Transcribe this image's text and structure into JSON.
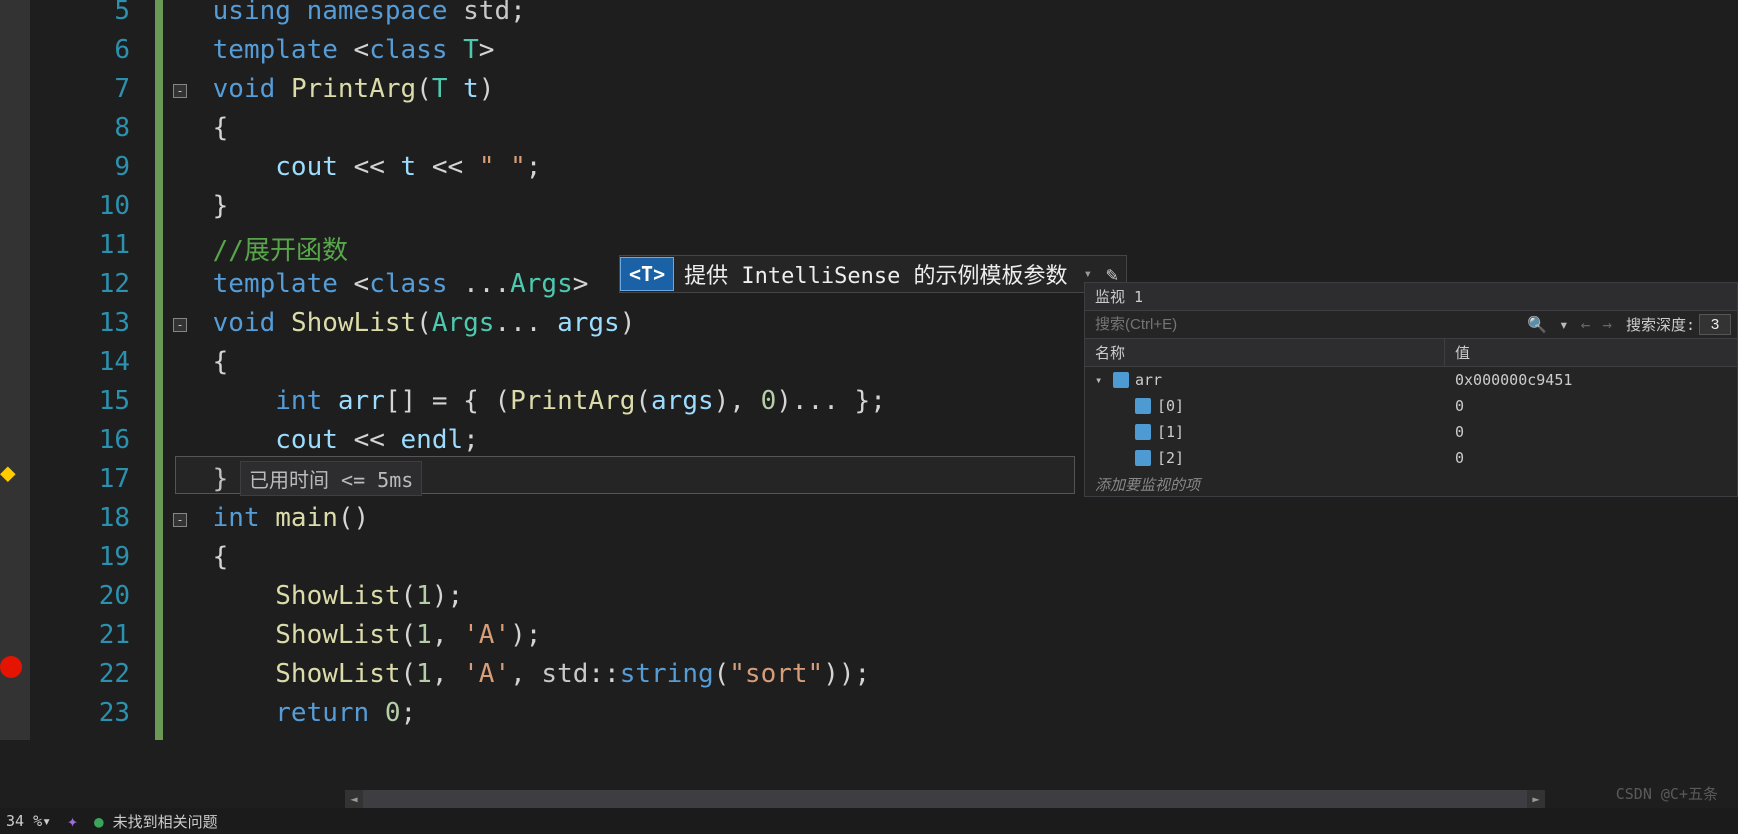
{
  "lines": [
    {
      "num": 5,
      "html": " <span class='kw'>using</span> <span class='kw'>namespace</span> <span class='ns'>std</span><span class='punc'>;</span>"
    },
    {
      "num": 6,
      "html": " <span class='kw'>template</span> <span class='punc'>&lt;</span><span class='kw'>class</span> <span class='tparam'>T</span><span class='punc'>&gt;</span>"
    },
    {
      "num": 7,
      "html": " <span class='kw'>void</span> <span class='func'>PrintArg</span><span class='punc'>(</span><span class='tparam'>T</span> <span class='ident'>t</span><span class='punc'>)</span>",
      "fold": true
    },
    {
      "num": 8,
      "html": " <span class='punc'>{</span>"
    },
    {
      "num": 9,
      "html": "     <span class='ident'>cout</span> <span class='op'>&lt;&lt;</span> <span class='ident'>t</span> <span class='op'>&lt;&lt;</span> <span class='str'>\" \"</span><span class='punc'>;</span>"
    },
    {
      "num": 10,
      "html": " <span class='punc'>}</span>"
    },
    {
      "num": 11,
      "html": " <span class='comment'>//展开函数</span>"
    },
    {
      "num": 12,
      "html": " <span class='kw'>template</span> <span class='punc'>&lt;</span><span class='kw'>class</span> <span class='punc'>...</span><span class='tparam'>Args</span><span class='punc'>&gt;</span>"
    },
    {
      "num": 13,
      "html": " <span class='kw'>void</span> <span class='func'>ShowList</span><span class='punc'>(</span><span class='tparam'>Args</span><span class='punc'>...</span> <span class='ident'>args</span><span class='punc'>)</span>",
      "fold": true
    },
    {
      "num": 14,
      "html": " <span class='punc'>{</span>"
    },
    {
      "num": 15,
      "html": "     <span class='kw'>int</span> <span class='ident'>arr</span><span class='punc'>[]</span> <span class='op'>=</span> <span class='punc'>{</span> <span class='punc'>(</span><span class='func'>PrintArg</span><span class='punc'>(</span><span class='ident'>args</span><span class='punc'>),</span> <span class='num'>0</span><span class='punc'>)...</span> <span class='punc'>};</span>"
    },
    {
      "num": 16,
      "html": "     <span class='ident'>cout</span> <span class='op'>&lt;&lt;</span> <span class='ident'>endl</span><span class='punc'>;</span>"
    },
    {
      "num": 17,
      "html": " <span class='punc'>}</span>"
    },
    {
      "num": 18,
      "html": " <span class='kw'>int</span> <span class='func'>main</span><span class='punc'>()</span>",
      "fold": true
    },
    {
      "num": 19,
      "html": " <span class='punc'>{</span>"
    },
    {
      "num": 20,
      "html": "     <span class='func'>ShowList</span><span class='punc'>(</span><span class='num'>1</span><span class='punc'>);</span>"
    },
    {
      "num": 21,
      "html": "     <span class='func'>ShowList</span><span class='punc'>(</span><span class='num'>1</span><span class='punc'>,</span> <span class='str'>'A'</span><span class='punc'>);</span>"
    },
    {
      "num": 22,
      "html": "     <span class='func'>ShowList</span><span class='punc'>(</span><span class='num'>1</span><span class='punc'>,</span> <span class='str'>'A'</span><span class='punc'>,</span> <span class='ns'>std</span><span class='punc'>::</span><span class='type'>string</span><span class='punc'>(</span><span class='str'>\"sort\"</span><span class='punc'>));</span>"
    },
    {
      "num": 23,
      "html": "     <span class='kw'>return</span> <span class='num'>0</span><span class='punc'>;</span>"
    }
  ],
  "lineHeight": 39,
  "topOffset": -4,
  "intellisense": {
    "tag": "<T>",
    "text": "提供 IntelliSense 的示例模板参数"
  },
  "timeLabel": "已用时间 <= 5ms",
  "watch": {
    "title": "监视 1",
    "searchPlaceholder": "搜索(Ctrl+E)",
    "depthLabel": "搜索深度:",
    "depthValue": "3",
    "colName": "名称",
    "colValue": "值",
    "rows": [
      {
        "indent": 0,
        "expand": "▾",
        "name": "arr",
        "value": "0x000000c9451"
      },
      {
        "indent": 1,
        "expand": "",
        "name": "[0]",
        "value": "0"
      },
      {
        "indent": 1,
        "expand": "",
        "name": "[1]",
        "value": "0"
      },
      {
        "indent": 1,
        "expand": "",
        "name": "[2]",
        "value": "0"
      }
    ],
    "addHint": "添加要监视的项"
  },
  "status": {
    "zoom": "34 %",
    "issues": "未找到相关问题"
  },
  "watermark": "CSDN @C+五条"
}
